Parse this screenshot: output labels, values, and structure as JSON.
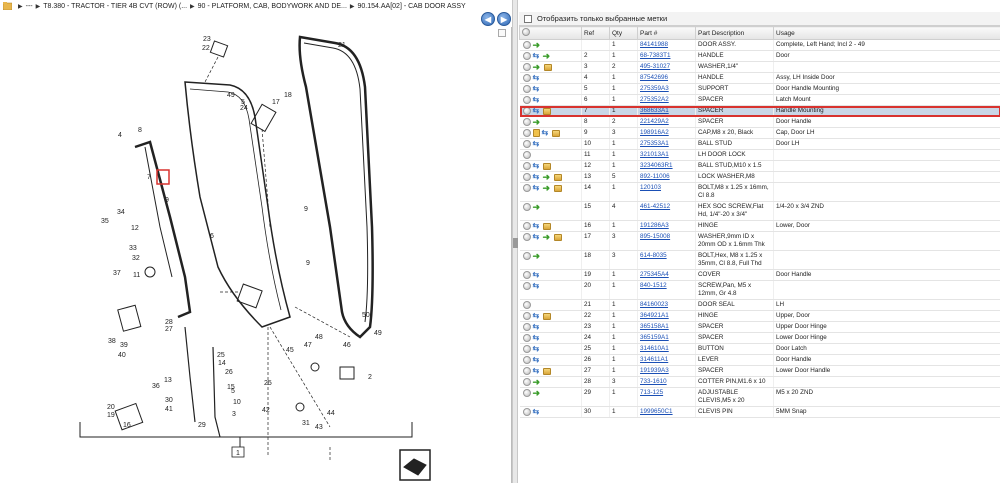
{
  "breadcrumb": {
    "items": [
      "---",
      "T8.380 - TRACTOR - TIER 4B CVT (ROW) (...",
      "90 - PLATFORM, CAB, BODYWORK AND DE...",
      "90.154.AA[02] - CAB DOOR ASSY"
    ]
  },
  "nav": {
    "back_icon": "back-arrow-icon",
    "forward_icon": "forward-arrow-icon"
  },
  "filter": {
    "label": "Отобразить только выбранные метки"
  },
  "table": {
    "headers": {
      "ref": "Ref",
      "qty": "Qty",
      "part": "Part #",
      "desc": "Part Description",
      "usage": "Usage"
    },
    "rows": [
      {
        "icons": [
          "circle",
          "arrow"
        ],
        "ref": "",
        "qty": "1",
        "part": "84141988",
        "desc": "DOOR ASSY.",
        "usage": "Complete, Left Hand;  Incl 2 - 49",
        "sel": false
      },
      {
        "icons": [
          "circle",
          "link",
          "arrow"
        ],
        "ref": "2",
        "qty": "1",
        "part": "68-7383T1",
        "desc": "HANDLE",
        "usage": "Door",
        "sel": false
      },
      {
        "icons": [
          "circle",
          "arrow",
          "box"
        ],
        "ref": "3",
        "qty": "2",
        "part": "495-31027",
        "desc": "WASHER,1/4\"",
        "usage": "",
        "sel": false
      },
      {
        "icons": [
          "circle",
          "link"
        ],
        "ref": "4",
        "qty": "1",
        "part": "87542696",
        "desc": "HANDLE",
        "usage": "Assy, LH Inside Door",
        "sel": false
      },
      {
        "icons": [
          "circle",
          "link"
        ],
        "ref": "5",
        "qty": "1",
        "part": "275359A3",
        "desc": "SUPPORT",
        "usage": "Door Handle Mounting",
        "sel": false
      },
      {
        "icons": [
          "circle",
          "link"
        ],
        "ref": "6",
        "qty": "1",
        "part": "275352A2",
        "desc": "SPACER",
        "usage": "Latch Mount",
        "sel": false
      },
      {
        "icons": [
          "circle",
          "link",
          "box"
        ],
        "ref": "7",
        "qty": "1",
        "part": "368633A1",
        "desc": "SPACER",
        "usage": "Handle Mounting",
        "sel": true
      },
      {
        "icons": [
          "circle",
          "arrow"
        ],
        "ref": "8",
        "qty": "2",
        "part": "221429A2",
        "desc": "SPACER",
        "usage": "Door Handle",
        "sel": false
      },
      {
        "icons": [
          "circle",
          "lock",
          "link",
          "box"
        ],
        "ref": "9",
        "qty": "3",
        "part": "198916A2",
        "desc": "CAP,M8 x 20, Black",
        "usage": "Cap, Door LH",
        "sel": false
      },
      {
        "icons": [
          "circle",
          "link"
        ],
        "ref": "10",
        "qty": "1",
        "part": "275353A1",
        "desc": "BALL STUD",
        "usage": "Door LH",
        "sel": false
      },
      {
        "icons": [
          "circle"
        ],
        "ref": "11",
        "qty": "1",
        "part": "321013A1",
        "desc": "LH DOOR LOCK",
        "usage": "",
        "sel": false
      },
      {
        "icons": [
          "circle",
          "link",
          "box"
        ],
        "ref": "12",
        "qty": "1",
        "part": "3234063R1",
        "desc": "BALL STUD,M10 x 1.5",
        "usage": "",
        "sel": false
      },
      {
        "icons": [
          "circle",
          "link",
          "arrow",
          "box"
        ],
        "ref": "13",
        "qty": "5",
        "part": "892-11006",
        "desc": "LOCK WASHER,M8",
        "usage": "",
        "sel": false
      },
      {
        "icons": [
          "circle",
          "link",
          "arrow",
          "box"
        ],
        "ref": "14",
        "qty": "1",
        "part": "120103",
        "desc": "BOLT,M8 x 1.25 x 16mm, Cl 8.8",
        "usage": "",
        "sel": false
      },
      {
        "icons": [
          "circle",
          "arrow"
        ],
        "ref": "15",
        "qty": "4",
        "part": "461-42512",
        "desc": "HEX SOC SCREW,Flat Hd, 1/4\"-20 x 3/4\"",
        "usage": "1/4-20 x 3/4 ZND",
        "sel": false
      },
      {
        "icons": [
          "circle",
          "link",
          "box"
        ],
        "ref": "16",
        "qty": "1",
        "part": "191286A3",
        "desc": "HINGE",
        "usage": "Lower, Door",
        "sel": false
      },
      {
        "icons": [
          "circle",
          "link",
          "arrow",
          "box"
        ],
        "ref": "17",
        "qty": "3",
        "part": "895-15008",
        "desc": "WASHER,9mm ID x 20mm OD x 1.6mm Thk",
        "usage": "",
        "sel": false
      },
      {
        "icons": [
          "circle",
          "arrow"
        ],
        "ref": "18",
        "qty": "3",
        "part": "614-8035",
        "desc": "BOLT,Hex, M8 x 1.25 x 35mm, Cl 8.8, Full Thd",
        "usage": "",
        "sel": false
      },
      {
        "icons": [
          "circle",
          "link"
        ],
        "ref": "19",
        "qty": "1",
        "part": "275345A4",
        "desc": "COVER",
        "usage": "Door Handle",
        "sel": false
      },
      {
        "icons": [
          "circle",
          "link"
        ],
        "ref": "20",
        "qty": "1",
        "part": "840-1512",
        "desc": "SCREW,Pan, M5 x 12mm, Gr 4.8",
        "usage": "",
        "sel": false
      },
      {
        "icons": [
          "circle"
        ],
        "ref": "21",
        "qty": "1",
        "part": "84160023",
        "desc": "DOOR SEAL",
        "usage": "LH",
        "sel": false
      },
      {
        "icons": [
          "circle",
          "link",
          "box"
        ],
        "ref": "22",
        "qty": "1",
        "part": "364921A1",
        "desc": "HINGE",
        "usage": "Upper, Door",
        "sel": false
      },
      {
        "icons": [
          "circle",
          "link"
        ],
        "ref": "23",
        "qty": "1",
        "part": "365158A1",
        "desc": "SPACER",
        "usage": "Upper Door Hinge",
        "sel": false
      },
      {
        "icons": [
          "circle",
          "link"
        ],
        "ref": "24",
        "qty": "1",
        "part": "365159A1",
        "desc": "SPACER",
        "usage": "Lower Door Hinge",
        "sel": false
      },
      {
        "icons": [
          "circle",
          "link"
        ],
        "ref": "25",
        "qty": "1",
        "part": "314610A1",
        "desc": "BUTTON",
        "usage": "Door Latch",
        "sel": false
      },
      {
        "icons": [
          "circle",
          "link"
        ],
        "ref": "26",
        "qty": "1",
        "part": "314611A1",
        "desc": "LEVER",
        "usage": "Door Handle",
        "sel": false
      },
      {
        "icons": [
          "circle",
          "link",
          "box"
        ],
        "ref": "27",
        "qty": "1",
        "part": "191939A3",
        "desc": "SPACER",
        "usage": "Lower Door Handle",
        "sel": false
      },
      {
        "icons": [
          "circle",
          "arrow"
        ],
        "ref": "28",
        "qty": "3",
        "part": "733-1610",
        "desc": "COTTER PIN,M1.6 x 10",
        "usage": "",
        "sel": false
      },
      {
        "icons": [
          "circle",
          "arrow"
        ],
        "ref": "29",
        "qty": "1",
        "part": "713-125",
        "desc": "ADJUSTABLE CLEVIS,M5 x 20",
        "usage": "M5 x 20 ZND",
        "sel": false
      },
      {
        "icons": [
          "circle",
          "link"
        ],
        "ref": "30",
        "qty": "1",
        "part": "1999650C1",
        "desc": "CLEVIS PIN",
        "usage": "5MM Snap",
        "sel": false
      }
    ]
  },
  "diagram": {
    "callouts": [
      "23",
      "22",
      "21",
      "49",
      "5",
      "24",
      "17",
      "18",
      "4",
      "8",
      "7",
      "9",
      "34",
      "35",
      "12",
      "33",
      "32",
      "11",
      "37",
      "6",
      "9",
      "36",
      "38",
      "39",
      "40",
      "28",
      "27",
      "25",
      "14",
      "26",
      "15",
      "13",
      "31",
      "10",
      "30",
      "41",
      "29",
      "3",
      "42",
      "43",
      "44",
      "45",
      "47",
      "48",
      "46",
      "2",
      "1",
      "19",
      "20",
      "16"
    ],
    "frame_label": "1"
  }
}
